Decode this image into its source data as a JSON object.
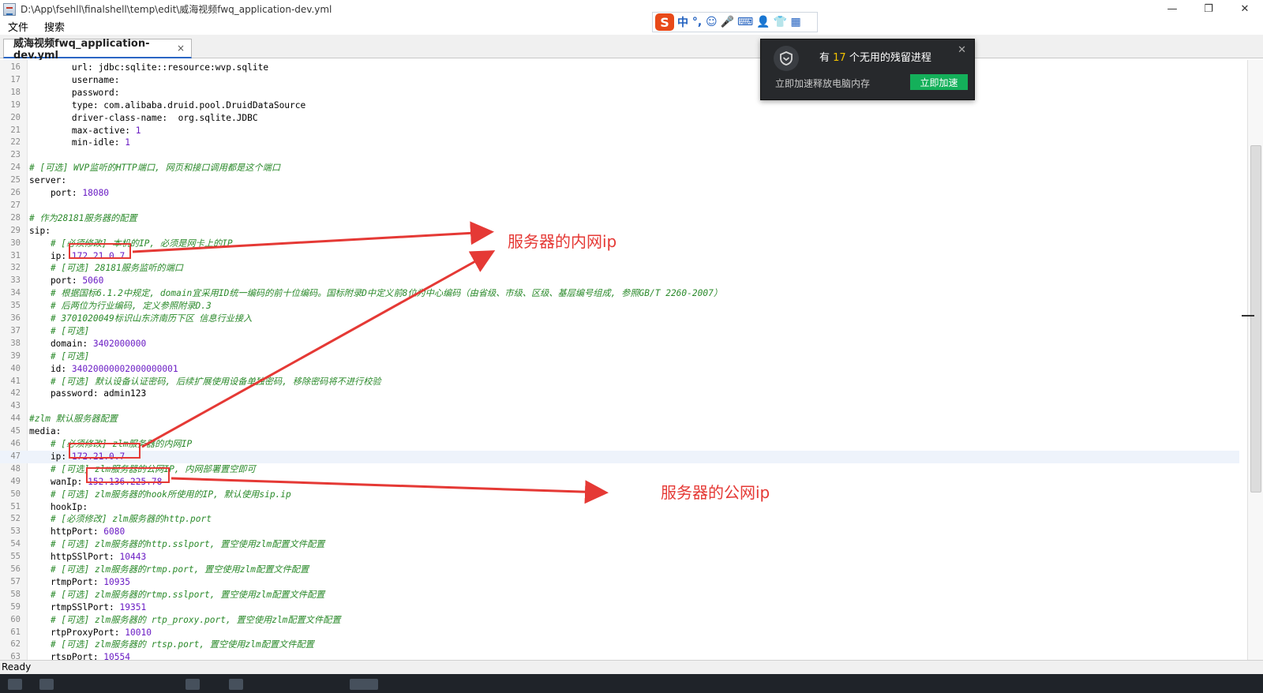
{
  "window": {
    "title": "D:\\App\\fsehll\\finalshell\\temp\\edit\\威海视频fwq_application-dev.yml",
    "min_glyph": "—",
    "max_glyph": "❐",
    "close_glyph": "✕"
  },
  "ime": {
    "logo": "S",
    "items": [
      "中",
      "°,",
      "☺",
      "🎤",
      "⌨",
      "👤",
      "👕",
      "▦"
    ]
  },
  "menu": [
    "文件",
    "搜索"
  ],
  "tab": {
    "label": "威海视频fwq_application-dev.yml",
    "close": "×"
  },
  "lines": [
    {
      "n": "16",
      "key": "        url: ",
      "val": "jdbc:sqlite::resource:wvp.sqlite",
      "type": "str"
    },
    {
      "n": "17",
      "key": "        username:",
      "val": "",
      "type": "str"
    },
    {
      "n": "18",
      "key": "        password:",
      "val": "",
      "type": "str"
    },
    {
      "n": "19",
      "key": "        type: ",
      "val": "com.alibaba.druid.pool.DruidDataSource",
      "type": "str"
    },
    {
      "n": "20",
      "key": "        driver-class-name:  ",
      "val": "org.sqlite.JDBC",
      "type": "str"
    },
    {
      "n": "21",
      "key": "        max-active: ",
      "val": "1",
      "type": "num"
    },
    {
      "n": "22",
      "key": "        min-idle: ",
      "val": "1",
      "type": "num"
    },
    {
      "n": "23",
      "key": "",
      "val": "",
      "type": "str"
    },
    {
      "n": "24",
      "key": "",
      "val": "# [可选] WVP监听的HTTP端口, 网页和接口调用都是这个端口",
      "type": "comment"
    },
    {
      "n": "25",
      "key": "server:",
      "val": "",
      "type": "str"
    },
    {
      "n": "26",
      "key": "    port: ",
      "val": "18080",
      "type": "num"
    },
    {
      "n": "27",
      "key": "",
      "val": "",
      "type": "str"
    },
    {
      "n": "28",
      "key": "",
      "val": "# 作为28181服务器的配置",
      "type": "comment"
    },
    {
      "n": "29",
      "key": "sip:",
      "val": "",
      "type": "str"
    },
    {
      "n": "30",
      "key": "    ",
      "val": "# [必须修改] 本机的IP, 必须是网卡上的IP",
      "type": "comment"
    },
    {
      "n": "31",
      "key": "    ip: ",
      "val": "172.21.0.7",
      "type": "num"
    },
    {
      "n": "32",
      "key": "    ",
      "val": "# [可选] 28181服务监听的端口",
      "type": "comment"
    },
    {
      "n": "33",
      "key": "    port: ",
      "val": "5060",
      "type": "num"
    },
    {
      "n": "34",
      "key": "    ",
      "val": "# 根据国标6.1.2中规定, domain宜采用ID统一编码的前十位编码。国标附录D中定义前8位为中心编码（由省级、市级、区级、基层编号组成, 参照GB/T 2260-2007）",
      "type": "comment"
    },
    {
      "n": "35",
      "key": "    ",
      "val": "# 后两位为行业编码, 定义参照附录D.3",
      "type": "comment"
    },
    {
      "n": "36",
      "key": "    ",
      "val": "# 3701020049标识山东济南历下区 信息行业接入",
      "type": "comment"
    },
    {
      "n": "37",
      "key": "    ",
      "val": "# [可选]",
      "type": "comment"
    },
    {
      "n": "38",
      "key": "    domain: ",
      "val": "3402000000",
      "type": "num"
    },
    {
      "n": "39",
      "key": "    ",
      "val": "# [可选]",
      "type": "comment"
    },
    {
      "n": "40",
      "key": "    id: ",
      "val": "34020000002000000001",
      "type": "num"
    },
    {
      "n": "41",
      "key": "    ",
      "val": "# [可选] 默认设备认证密码, 后续扩展使用设备单独密码, 移除密码将不进行校验",
      "type": "comment"
    },
    {
      "n": "42",
      "key": "    password: ",
      "val": "admin123",
      "type": "str"
    },
    {
      "n": "43",
      "key": "",
      "val": "",
      "type": "str"
    },
    {
      "n": "44",
      "key": "",
      "val": "#zlm 默认服务器配置",
      "type": "comment"
    },
    {
      "n": "45",
      "key": "media:",
      "val": "",
      "type": "str"
    },
    {
      "n": "46",
      "key": "    ",
      "val": "# [必须修改] zlm服务器的内网IP",
      "type": "comment"
    },
    {
      "n": "47",
      "key": "    ip: ",
      "val": "172.21.0.7",
      "type": "num"
    },
    {
      "n": "48",
      "key": "    ",
      "val": "# [可选] zlm服务器的公网IP, 内网部署置空即可",
      "type": "comment"
    },
    {
      "n": "49",
      "key": "    wanIp: ",
      "val": "152.136.225.78",
      "type": "num"
    },
    {
      "n": "50",
      "key": "    ",
      "val": "# [可选] zlm服务器的hook所使用的IP, 默认使用sip.ip",
      "type": "comment"
    },
    {
      "n": "51",
      "key": "    hookIp:",
      "val": "",
      "type": "str"
    },
    {
      "n": "52",
      "key": "    ",
      "val": "# [必须修改] zlm服务器的http.port",
      "type": "comment"
    },
    {
      "n": "53",
      "key": "    httpPort: ",
      "val": "6080",
      "type": "num"
    },
    {
      "n": "54",
      "key": "    ",
      "val": "# [可选] zlm服务器的http.sslport, 置空使用zlm配置文件配置",
      "type": "comment"
    },
    {
      "n": "55",
      "key": "    httpSSlPort: ",
      "val": "10443",
      "type": "num"
    },
    {
      "n": "56",
      "key": "    ",
      "val": "# [可选] zlm服务器的rtmp.port, 置空使用zlm配置文件配置",
      "type": "comment"
    },
    {
      "n": "57",
      "key": "    rtmpPort: ",
      "val": "10935",
      "type": "num"
    },
    {
      "n": "58",
      "key": "    ",
      "val": "# [可选] zlm服务器的rtmp.sslport, 置空使用zlm配置文件配置",
      "type": "comment"
    },
    {
      "n": "59",
      "key": "    rtmpSSlPort: ",
      "val": "19351",
      "type": "num"
    },
    {
      "n": "60",
      "key": "    ",
      "val": "# [可选] zlm服务器的 rtp_proxy.port, 置空使用zlm配置文件配置",
      "type": "comment"
    },
    {
      "n": "61",
      "key": "    rtpProxyPort: ",
      "val": "10010",
      "type": "num"
    },
    {
      "n": "62",
      "key": "    ",
      "val": "# [可选] zlm服务器的 rtsp.port, 置空使用zlm配置文件配置",
      "type": "comment"
    },
    {
      "n": "63",
      "key": "    rtspPort: ",
      "val": "10554",
      "type": "num"
    }
  ],
  "status": {
    "text": "Ready"
  },
  "notification": {
    "title_prefix": "有 ",
    "count": "17",
    "title_suffix": " 个无用的残留进程",
    "subtitle": "立即加速释放电脑内存",
    "button": "立即加速",
    "close": "✕"
  },
  "annotations": {
    "inner_ip_label": "服务器的内网ip",
    "public_ip_label": "服务器的公网ip",
    "color": "#e53935"
  }
}
